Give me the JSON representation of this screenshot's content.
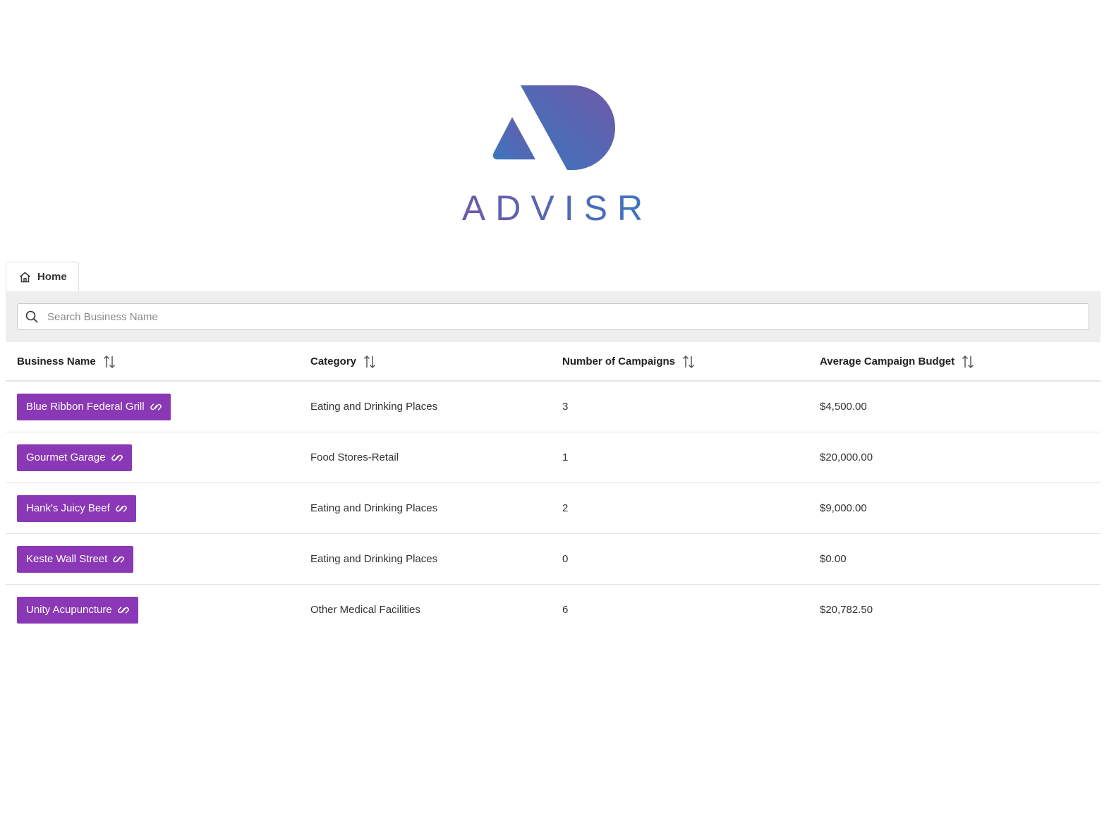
{
  "brand": {
    "wordmark": "ADVISR",
    "logo_icon": "advisr-logo-icon"
  },
  "tabs": [
    {
      "label": "Home",
      "icon": "home-icon"
    }
  ],
  "search": {
    "placeholder": "Search Business Name",
    "value": "",
    "icon": "search-icon"
  },
  "table": {
    "columns": [
      {
        "label": "Business Name",
        "sort_icon": "sort-icon"
      },
      {
        "label": "Category",
        "sort_icon": "sort-icon"
      },
      {
        "label": "Number of Campaigns",
        "sort_icon": "sort-icon"
      },
      {
        "label": "Average Campaign Budget",
        "sort_icon": "sort-icon"
      }
    ],
    "rows": [
      {
        "name": "Blue Ribbon Federal Grill",
        "category": "Eating and Drinking Places",
        "campaigns": "3",
        "budget": "$4,500.00"
      },
      {
        "name": "Gourmet Garage",
        "category": "Food Stores-Retail",
        "campaigns": "1",
        "budget": "$20,000.00"
      },
      {
        "name": "Hank's Juicy Beef",
        "category": "Eating and Drinking Places",
        "campaigns": "2",
        "budget": "$9,000.00"
      },
      {
        "name": "Keste Wall Street",
        "category": "Eating and Drinking Places",
        "campaigns": "0",
        "budget": "$0.00"
      },
      {
        "name": "Unity Acupuncture",
        "category": "Other Medical Facilities",
        "campaigns": "6",
        "budget": "$20,782.50"
      }
    ],
    "link_icon": "link-icon"
  },
  "colors": {
    "accent_button": "#8a38b5",
    "logo_gradient_start": "#3a76bf",
    "logo_gradient_end": "#6e5aa8",
    "search_band": "#eeeeee"
  }
}
